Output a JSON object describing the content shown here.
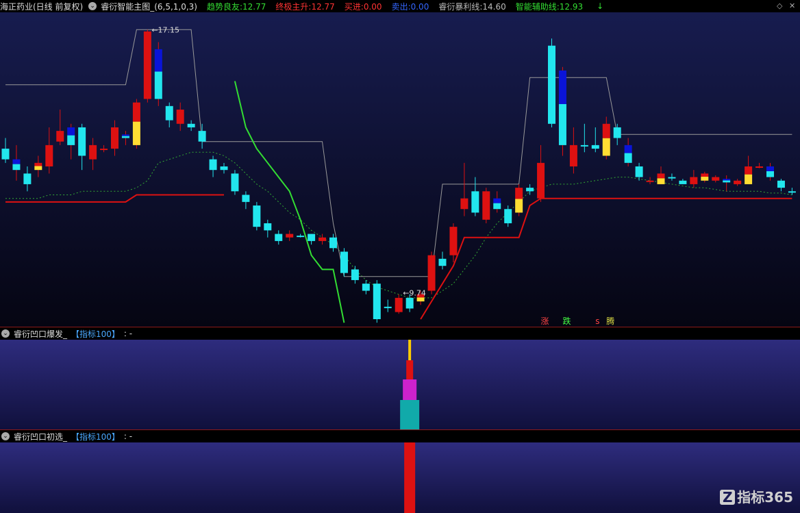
{
  "header": {
    "stock_name": "海正药业(日线 前复权)",
    "main_indicator": "睿衍智能主图_(6,5,1,0,3)",
    "items": [
      {
        "label": "趋势良友:",
        "value": "12.77",
        "label_color": "#33dd33",
        "value_color": "#33dd33"
      },
      {
        "label": "终极主升:",
        "value": "12.77",
        "label_color": "#ff3333",
        "value_color": "#ff3333"
      },
      {
        "label": "买进:",
        "value": "0.00",
        "label_color": "#ff3333",
        "value_color": "#ff3333"
      },
      {
        "label": "卖出:",
        "value": "0.00",
        "label_color": "#3366ff",
        "value_color": "#3366ff"
      },
      {
        "label": "睿衍暴利线:",
        "value": "14.60",
        "label_color": "#bbbbbb",
        "value_color": "#bbbbbb"
      },
      {
        "label": "智能辅助线:",
        "value": "12.93",
        "label_color": "#33dd33",
        "value_color": "#33dd33"
      }
    ],
    "arrow": "↓",
    "controls": [
      "◇",
      "✕"
    ]
  },
  "sub1": {
    "title": "睿衍凹口爆发_",
    "param": "【指标100】",
    "suffix": ": -"
  },
  "sub2": {
    "title": "睿衍凹口初选_",
    "param": "【指标100】",
    "suffix": ": -"
  },
  "logo": {
    "mark": "Z",
    "text": "指标365"
  },
  "colors": {
    "up": "#dd1111",
    "down": "#22e6ee",
    "hold_yellow": "#ffdd33",
    "hold_blue": "#0a14d8",
    "green_line": "#33dd33",
    "red_line": "#dd1111",
    "gray_line": "#999999",
    "dotted": "#33aa33"
  },
  "chart_data": {
    "type": "candlestick",
    "ylim": [
      9.0,
      17.6
    ],
    "annotations": [
      {
        "label": "17.15",
        "x": 13,
        "y": 17.15
      },
      {
        "label": "9.74",
        "x": 36,
        "y": 9.74
      }
    ],
    "bottom_labels": [
      {
        "text": "涨",
        "x": 49,
        "color": "#ff4444"
      },
      {
        "text": "跌",
        "x": 51,
        "color": "#44ff44"
      },
      {
        "text": "s",
        "x": 54,
        "color": "#ff4444"
      },
      {
        "text": "腾",
        "x": 55,
        "color": "#dddd44"
      }
    ],
    "candles": [
      {
        "o": 13.8,
        "c": 13.5,
        "h": 14.1,
        "l": 13.4,
        "type": "down"
      },
      {
        "o": 13.5,
        "c": 13.2,
        "h": 13.9,
        "l": 12.9,
        "type": "blue"
      },
      {
        "o": 13.1,
        "c": 12.8,
        "h": 13.3,
        "l": 12.6,
        "type": "down"
      },
      {
        "o": 13.2,
        "c": 13.4,
        "h": 13.6,
        "l": 13.0,
        "type": "yellow"
      },
      {
        "o": 13.3,
        "c": 13.9,
        "h": 14.4,
        "l": 13.1,
        "type": "up"
      },
      {
        "o": 14.0,
        "c": 14.3,
        "h": 14.9,
        "l": 13.9,
        "type": "up"
      },
      {
        "o": 13.9,
        "c": 14.4,
        "h": 14.5,
        "l": 13.5,
        "type": "blue"
      },
      {
        "o": 14.4,
        "c": 13.6,
        "h": 14.5,
        "l": 13.2,
        "type": "down"
      },
      {
        "o": 13.5,
        "c": 13.9,
        "h": 14.1,
        "l": 13.2,
        "type": "up"
      },
      {
        "o": 13.8,
        "c": 13.8,
        "h": 13.9,
        "l": 13.7,
        "type": "up"
      },
      {
        "o": 13.8,
        "c": 14.4,
        "h": 14.6,
        "l": 13.6,
        "type": "up"
      },
      {
        "o": 14.2,
        "c": 14.1,
        "h": 14.3,
        "l": 13.9,
        "type": "blue"
      },
      {
        "o": 13.9,
        "c": 15.1,
        "h": 15.2,
        "l": 13.8,
        "type": "yellow"
      },
      {
        "o": 15.2,
        "c": 17.1,
        "h": 17.15,
        "l": 15.1,
        "type": "up"
      },
      {
        "o": 16.6,
        "c": 15.2,
        "h": 16.8,
        "l": 15.0,
        "type": "blue"
      },
      {
        "o": 15.0,
        "c": 14.6,
        "h": 15.1,
        "l": 14.4,
        "type": "down"
      },
      {
        "o": 14.5,
        "c": 14.9,
        "h": 15.1,
        "l": 14.3,
        "type": "up"
      },
      {
        "o": 14.5,
        "c": 14.4,
        "h": 14.6,
        "l": 14.3,
        "type": "down"
      },
      {
        "o": 14.3,
        "c": 14.0,
        "h": 14.5,
        "l": 13.8,
        "type": "down"
      },
      {
        "o": 13.5,
        "c": 13.2,
        "h": 13.6,
        "l": 13.0,
        "type": "down"
      },
      {
        "o": 13.3,
        "c": 13.2,
        "h": 13.4,
        "l": 13.1,
        "type": "down"
      },
      {
        "o": 13.1,
        "c": 12.6,
        "h": 13.2,
        "l": 12.5,
        "type": "down"
      },
      {
        "o": 12.5,
        "c": 12.3,
        "h": 12.6,
        "l": 12.1,
        "type": "down"
      },
      {
        "o": 12.2,
        "c": 11.6,
        "h": 12.3,
        "l": 11.5,
        "type": "down"
      },
      {
        "o": 11.7,
        "c": 11.5,
        "h": 11.8,
        "l": 11.3,
        "type": "down"
      },
      {
        "o": 11.4,
        "c": 11.2,
        "h": 11.5,
        "l": 11.1,
        "type": "down"
      },
      {
        "o": 11.3,
        "c": 11.4,
        "h": 11.5,
        "l": 11.2,
        "type": "up"
      },
      {
        "o": 11.35,
        "c": 11.35,
        "h": 11.4,
        "l": 11.3,
        "type": "down"
      },
      {
        "o": 11.4,
        "c": 11.2,
        "h": 11.4,
        "l": 11.1,
        "type": "down"
      },
      {
        "o": 11.2,
        "c": 11.3,
        "h": 11.4,
        "l": 11.1,
        "type": "up"
      },
      {
        "o": 11.3,
        "c": 11.0,
        "h": 11.4,
        "l": 10.9,
        "type": "down"
      },
      {
        "o": 10.9,
        "c": 10.3,
        "h": 11.0,
        "l": 10.2,
        "type": "down"
      },
      {
        "o": 10.4,
        "c": 10.1,
        "h": 10.5,
        "l": 10.0,
        "type": "down"
      },
      {
        "o": 10.0,
        "c": 9.8,
        "h": 10.1,
        "l": 9.7,
        "type": "down"
      },
      {
        "o": 10.0,
        "c": 9.0,
        "h": 10.1,
        "l": 8.9,
        "type": "down"
      },
      {
        "o": 9.35,
        "c": 9.35,
        "h": 9.55,
        "l": 9.2,
        "type": "down"
      },
      {
        "o": 9.2,
        "c": 9.6,
        "h": 9.7,
        "l": 9.15,
        "type": "up"
      },
      {
        "o": 9.3,
        "c": 9.6,
        "h": 9.7,
        "l": 9.2,
        "type": "down"
      },
      {
        "o": 9.5,
        "c": 9.7,
        "h": 9.8,
        "l": 9.4,
        "type": "yellow"
      },
      {
        "o": 9.8,
        "c": 10.8,
        "h": 10.9,
        "l": 9.7,
        "type": "up"
      },
      {
        "o": 10.5,
        "c": 10.7,
        "h": 10.9,
        "l": 10.4,
        "type": "down"
      },
      {
        "o": 10.8,
        "c": 11.6,
        "h": 11.7,
        "l": 10.6,
        "type": "up"
      },
      {
        "o": 12.1,
        "c": 12.4,
        "h": 13.4,
        "l": 11.9,
        "type": "up"
      },
      {
        "o": 12.0,
        "c": 12.6,
        "h": 13.0,
        "l": 11.9,
        "type": "down"
      },
      {
        "o": 11.8,
        "c": 12.6,
        "h": 12.7,
        "l": 11.7,
        "type": "up"
      },
      {
        "o": 12.4,
        "c": 12.1,
        "h": 12.6,
        "l": 12.0,
        "type": "blue"
      },
      {
        "o": 12.1,
        "c": 11.7,
        "h": 12.2,
        "l": 11.6,
        "type": "down"
      },
      {
        "o": 12.0,
        "c": 12.7,
        "h": 12.8,
        "l": 11.9,
        "type": "yellow"
      },
      {
        "o": 12.6,
        "c": 12.7,
        "h": 12.8,
        "l": 12.5,
        "type": "down"
      },
      {
        "o": 12.4,
        "c": 13.4,
        "h": 13.9,
        "l": 12.3,
        "type": "up"
      },
      {
        "o": 14.5,
        "c": 16.7,
        "h": 16.9,
        "l": 14.4,
        "type": "down"
      },
      {
        "o": 16.0,
        "c": 13.9,
        "h": 16.1,
        "l": 13.6,
        "type": "blue"
      },
      {
        "o": 13.3,
        "c": 13.9,
        "h": 14.4,
        "l": 13.1,
        "type": "up"
      },
      {
        "o": 13.9,
        "c": 13.9,
        "h": 14.5,
        "l": 13.7,
        "type": "down"
      },
      {
        "o": 13.8,
        "c": 13.9,
        "h": 14.4,
        "l": 13.7,
        "type": "down"
      },
      {
        "o": 13.6,
        "c": 14.5,
        "h": 14.7,
        "l": 13.5,
        "type": "yellow"
      },
      {
        "o": 14.1,
        "c": 14.4,
        "h": 14.5,
        "l": 13.9,
        "type": "down"
      },
      {
        "o": 13.9,
        "c": 13.4,
        "h": 14.1,
        "l": 13.3,
        "type": "blue"
      },
      {
        "o": 13.3,
        "c": 13.0,
        "h": 13.4,
        "l": 12.9,
        "type": "down"
      },
      {
        "o": 12.9,
        "c": 12.9,
        "h": 13.0,
        "l": 12.8,
        "type": "up"
      },
      {
        "o": 12.8,
        "c": 13.1,
        "h": 13.3,
        "l": 12.8,
        "type": "yellow"
      },
      {
        "o": 13.0,
        "c": 13.0,
        "h": 13.1,
        "l": 12.9,
        "type": "down"
      },
      {
        "o": 12.8,
        "c": 12.9,
        "h": 12.95,
        "l": 12.8,
        "type": "down"
      },
      {
        "o": 12.8,
        "c": 13.0,
        "h": 13.2,
        "l": 12.7,
        "type": "up"
      },
      {
        "o": 12.9,
        "c": 13.1,
        "h": 13.15,
        "l": 12.85,
        "type": "yellow"
      },
      {
        "o": 12.9,
        "c": 13.0,
        "h": 13.05,
        "l": 12.85,
        "type": "up"
      },
      {
        "o": 12.85,
        "c": 12.95,
        "h": 13.05,
        "l": 12.6,
        "type": "blue"
      },
      {
        "o": 12.8,
        "c": 12.9,
        "h": 12.95,
        "l": 12.75,
        "type": "up"
      },
      {
        "o": 12.8,
        "c": 13.3,
        "h": 13.6,
        "l": 12.8,
        "type": "yellow"
      },
      {
        "o": 13.3,
        "c": 13.3,
        "h": 13.4,
        "l": 13.25,
        "type": "up"
      },
      {
        "o": 13.3,
        "c": 13.0,
        "h": 13.4,
        "l": 12.9,
        "type": "blue"
      },
      {
        "o": 12.9,
        "c": 12.7,
        "h": 12.95,
        "l": 12.6,
        "type": "down"
      },
      {
        "o": 12.6,
        "c": 12.6,
        "h": 12.7,
        "l": 12.5,
        "type": "down"
      }
    ],
    "series": [
      {
        "name": "趋势良友",
        "style": "dotted-green",
        "values": [
          12.4,
          12.4,
          12.4,
          12.4,
          12.5,
          12.5,
          12.5,
          12.6,
          12.6,
          12.6,
          12.6,
          12.6,
          12.7,
          12.9,
          13.4,
          13.5,
          13.6,
          13.7,
          13.7,
          13.7,
          13.6,
          13.4,
          13.1,
          12.8,
          12.6,
          12.3,
          12.0,
          11.8,
          11.5,
          11.3,
          11.1,
          10.8,
          10.4,
          10.1,
          9.9,
          9.8,
          9.7,
          9.6,
          9.6,
          9.6,
          9.8,
          10.0,
          10.4,
          10.8,
          11.3,
          11.7,
          12.0,
          12.3,
          12.6,
          12.7,
          12.8,
          12.8,
          12.8,
          12.85,
          12.9,
          12.95,
          13.0,
          13.0,
          12.95,
          12.9,
          12.85,
          12.8,
          12.75,
          12.7,
          12.7,
          12.65,
          12.6,
          12.6,
          12.6,
          12.6,
          12.55,
          12.55,
          12.5
        ]
      },
      {
        "name": "终极主升",
        "style": "solid-red",
        "values": [
          12.3,
          12.3,
          12.3,
          12.3,
          12.3,
          12.3,
          12.3,
          12.3,
          12.3,
          12.3,
          12.3,
          12.3,
          12.5,
          12.5,
          12.5,
          12.5,
          12.5,
          12.5,
          12.5,
          12.5,
          12.5,
          null,
          null,
          null,
          null,
          null,
          null,
          null,
          null,
          null,
          null,
          null,
          null,
          null,
          null,
          null,
          null,
          null,
          9.0,
          9.5,
          10.0,
          10.5,
          11.3,
          11.3,
          11.3,
          11.3,
          11.3,
          11.3,
          12.2,
          12.4,
          12.4,
          12.4,
          12.4,
          12.4,
          12.4,
          12.4,
          12.4,
          12.4,
          12.4,
          12.4,
          12.4,
          12.4,
          12.4,
          12.4,
          12.4,
          12.4,
          12.4,
          12.4,
          12.4,
          12.4,
          12.4,
          12.4,
          12.4
        ]
      },
      {
        "name": "睿衍暴利线",
        "style": "solid-gray",
        "values": [
          15.6,
          15.6,
          15.6,
          15.6,
          15.6,
          15.6,
          15.6,
          15.6,
          15.6,
          15.6,
          15.6,
          15.6,
          17.15,
          17.15,
          17.15,
          17.15,
          17.15,
          17.15,
          14.0,
          14.0,
          14.0,
          14.0,
          14.0,
          14.0,
          14.0,
          14.0,
          14.0,
          14.0,
          14.0,
          14.0,
          11.7,
          10.2,
          10.2,
          10.2,
          10.2,
          10.2,
          10.2,
          10.2,
          10.2,
          10.2,
          12.8,
          12.8,
          12.8,
          12.8,
          12.8,
          12.8,
          12.8,
          12.8,
          15.8,
          15.8,
          15.8,
          15.8,
          15.8,
          15.8,
          15.8,
          15.8,
          14.2,
          14.2,
          14.2,
          14.2,
          14.2,
          14.2,
          14.2,
          14.2,
          14.2,
          14.2,
          14.2,
          14.2,
          14.2,
          14.2,
          14.2,
          14.2,
          14.2
        ]
      },
      {
        "name": "智能辅助线",
        "style": "solid-green",
        "values": [
          null,
          null,
          null,
          null,
          null,
          null,
          null,
          null,
          null,
          null,
          null,
          null,
          null,
          null,
          null,
          null,
          null,
          null,
          null,
          null,
          null,
          15.7,
          14.4,
          13.8,
          13.4,
          13.0,
          12.6,
          11.8,
          10.8,
          10.4,
          10.4,
          8.9
        ]
      }
    ],
    "sub1_bars": [
      {
        "x": 37,
        "segments": [
          "#11aaaa",
          "#cc22cc",
          "#dd1111",
          "#ffcc00"
        ]
      }
    ],
    "sub2_bars": [
      {
        "x": 37,
        "color": "#dd1111"
      }
    ]
  }
}
